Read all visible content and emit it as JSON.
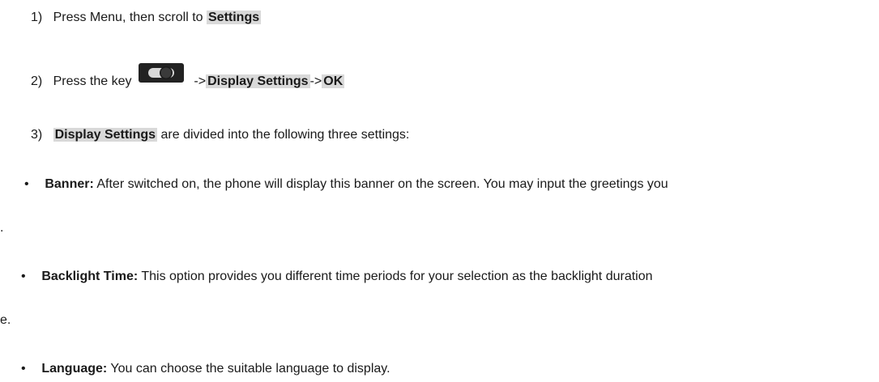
{
  "steps": [
    {
      "number": "1)",
      "text": "Press Menu, then scroll to ",
      "highlight": "Settings"
    },
    {
      "number": "2)",
      "text_before": "Press the key",
      "icon": "toggle-key-icon",
      "arrow1": "->",
      "highlight1": "Display Settings",
      "arrow2": "->",
      "highlight2": "OK"
    },
    {
      "number": "3)",
      "highlight": "Display Settings",
      "text": " are divided into the following three settings:"
    }
  ],
  "settings": [
    {
      "bullet": "•",
      "term": "Banner:",
      "desc": " After switched on, the phone will display this banner on the screen. You may input the greetings you",
      "continuation": "."
    },
    {
      "bullet": "•",
      "term": "Backlight Time:",
      "desc": " This option provides you different time periods for your selection as the backlight duration",
      "continuation": "e."
    },
    {
      "bullet": "•",
      "term": "Language:",
      "desc": " You can choose the suitable language to display."
    }
  ],
  "colors": {
    "highlight_bg": "#d9d9d9",
    "text": "#1a1a1a"
  }
}
